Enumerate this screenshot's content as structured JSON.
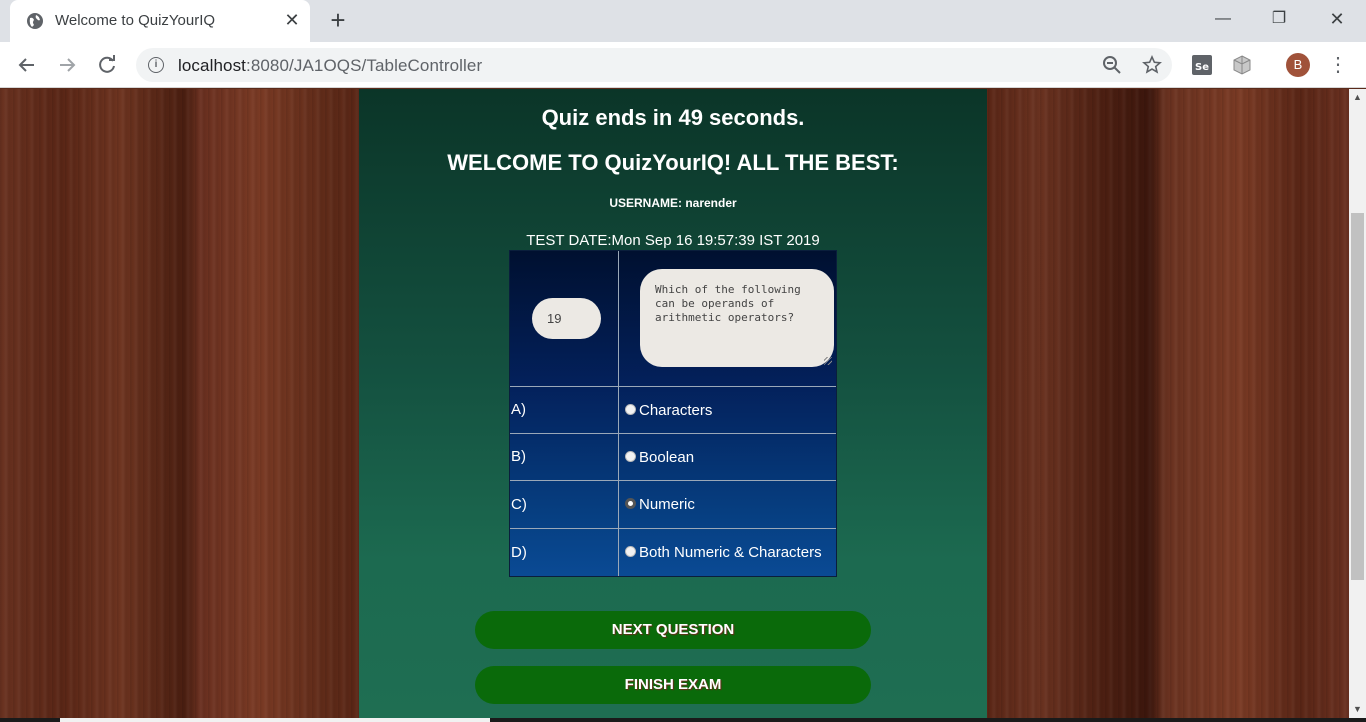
{
  "browser": {
    "tab_title": "Welcome to QuizYourIQ",
    "tab_close": "✕",
    "new_tab": "+",
    "url_host": "localhost",
    "url_rest": ":8080/JA1OQS/TableController",
    "avatar_letter": "B",
    "window_controls": {
      "minimize": "—",
      "maximize": "❐",
      "close": "✕"
    }
  },
  "quiz": {
    "countdown": "Quiz ends in 49 seconds.",
    "welcome": "WELCOME TO QuizYourIQ! ALL THE BEST:",
    "username": "USERNAME: narender",
    "test_date": "TEST DATE:Mon Sep 16 19:57:39 IST 2019",
    "question_number": "19",
    "question_text": "Which of the following can be operands of arithmetic operators?",
    "options": [
      {
        "letter": "A)",
        "label": "Characters",
        "selected": false
      },
      {
        "letter": "B)",
        "label": "Boolean",
        "selected": false
      },
      {
        "letter": "C)",
        "label": "Numeric",
        "selected": true
      },
      {
        "letter": "D)",
        "label": "Both Numeric & Characters",
        "selected": false
      }
    ],
    "next_button": "NEXT QUESTION",
    "finish_button": "FINISH EXAM"
  },
  "icons": {
    "tab_favicon": "globe-icon",
    "back": "back-arrow-icon",
    "forward": "forward-arrow-icon",
    "reload": "reload-icon",
    "site_info": "info-icon",
    "zoom": "zoom-out-icon",
    "bookmark": "star-icon",
    "extension1": "selenium-icon",
    "extension2": "cube-icon",
    "menu": "more-vert-icon"
  }
}
